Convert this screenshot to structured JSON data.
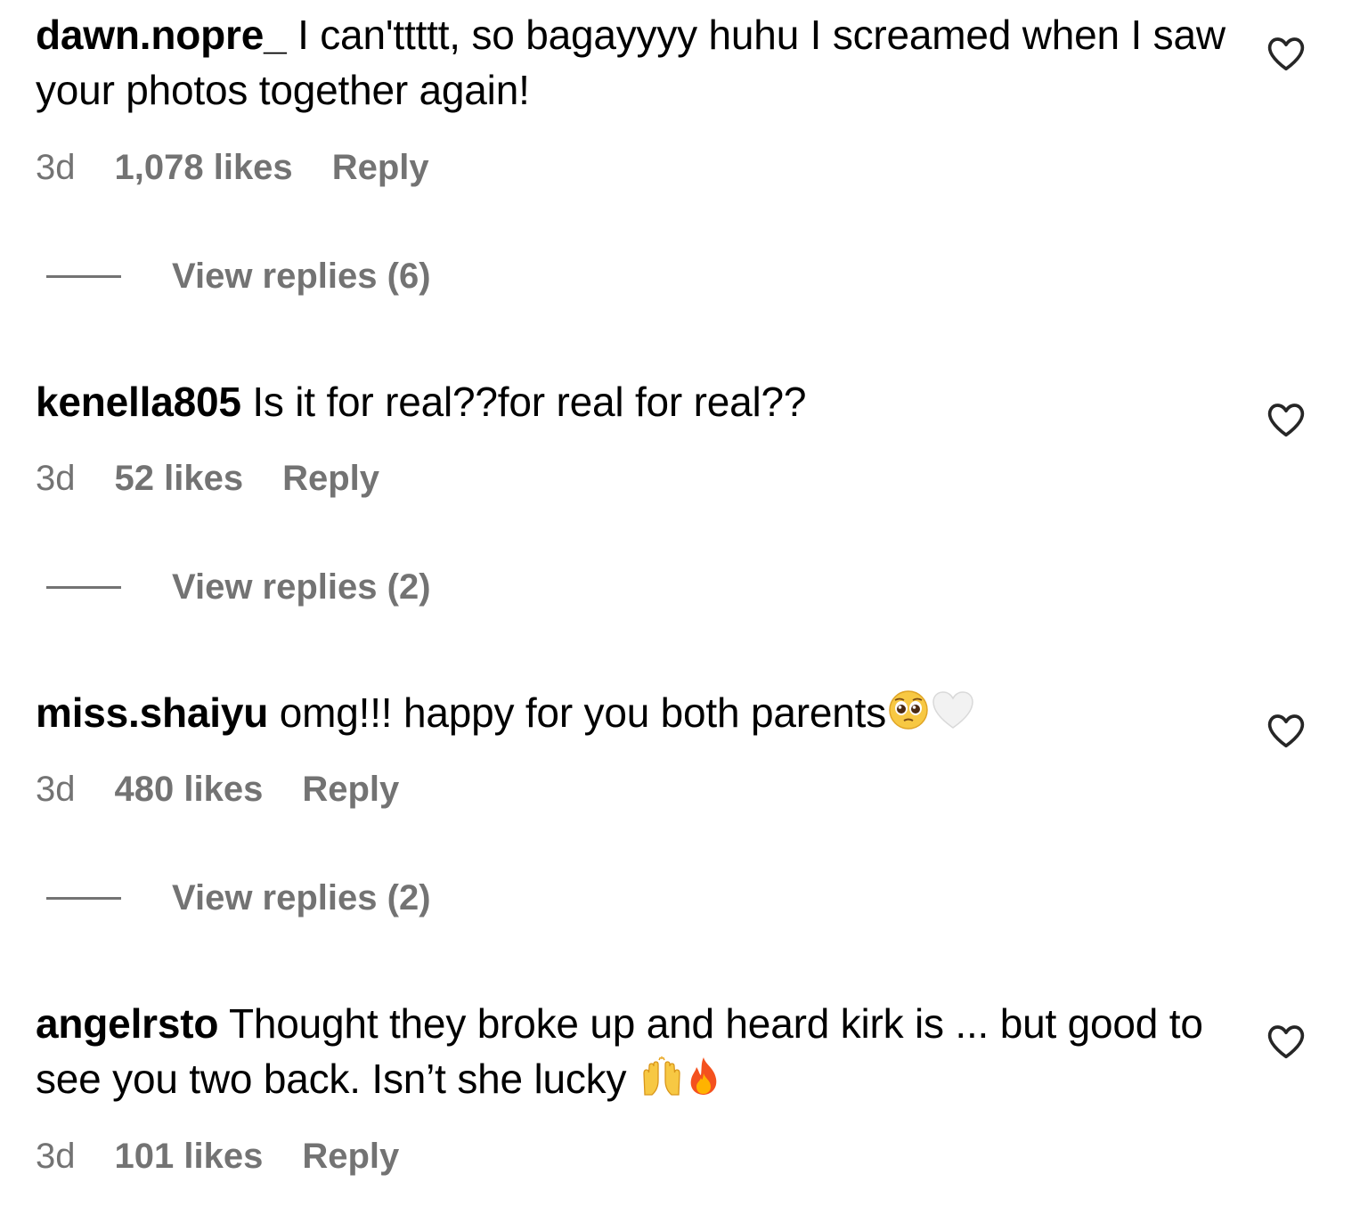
{
  "comments": [
    {
      "username": "dawn.nopre_",
      "text": " I can'ttttt, so bagayyyy huhu I screamed when I saw your photos together again!",
      "time": "3d",
      "likes": "1,078 likes",
      "reply": "Reply",
      "view_replies": "View replies (6)"
    },
    {
      "username": "kenella805",
      "text": " Is it for real??for real for real??",
      "time": "3d",
      "likes": "52 likes",
      "reply": "Reply",
      "view_replies": "View replies (2)"
    },
    {
      "username": "miss.shaiyu",
      "text": " omg!!! happy for you both parents",
      "emojis": [
        "pleading-face-emoji",
        "white-heart-emoji"
      ],
      "time": "3d",
      "likes": "480 likes",
      "reply": "Reply",
      "view_replies": "View replies (2)"
    },
    {
      "username": "angelrsto",
      "text": " Thought they broke up and heard kirk is ... but good to see you two back. Isn’t she lucky ",
      "emojis": [
        "raising-hands-emoji",
        "fire-emoji"
      ],
      "time": "3d",
      "likes": "101 likes",
      "reply": "Reply"
    }
  ],
  "icons": {
    "like": "heart-outline-icon"
  },
  "colors": {
    "text": "#000000",
    "secondary": "#737373",
    "background": "#ffffff"
  }
}
